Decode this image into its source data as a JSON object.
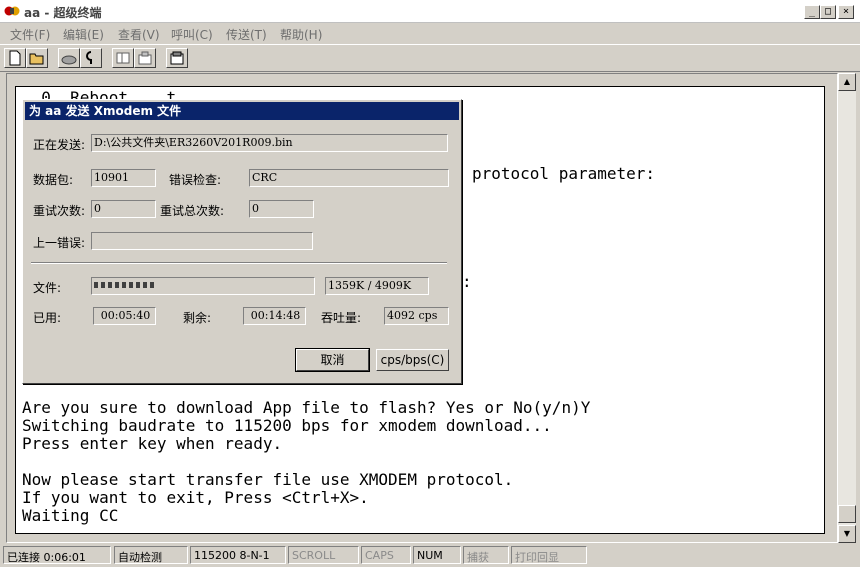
{
  "window": {
    "title": "aa - 超级终端",
    "minimize": "_",
    "maximize": "□",
    "close": "×"
  },
  "menu": [
    "文件(F)",
    "编辑(E)",
    "查看(V)",
    "呼叫(C)",
    "传送(T)",
    "帮助(H)"
  ],
  "toolbar": [
    "new-icon",
    "open-icon",
    "call-icon",
    "disconnect-icon",
    "send-icon",
    "receive-icon",
    "properties-icon"
  ],
  "terminal": {
    "top_partial": "  0. Reboot    t",
    "mid_fragment_1": "protocol parameter:",
    "mid_fragment_2": ":",
    "lines": [
      "Are you sure to download App file to flash? Yes or No(y/n)Y",
      "Switching baudrate to 115200 bps for xmodem download...",
      "Press enter key when ready.",
      "",
      "Now please start transfer file use XMODEM protocol.",
      "If you want to exit, Press <Ctrl+X>.",
      "Waiting CC"
    ]
  },
  "dialog": {
    "title": "为 aa 发送 Xmodem 文件",
    "sending_label": "正在发送:",
    "sending_value": "D:\\公共文件夹\\ER3260V201R009.bin",
    "packet_label": "数据包:",
    "packet_value": "10901",
    "error_check_label": "错误检查:",
    "error_check_value": "CRC",
    "retries_label": "重试次数:",
    "retries_value": "0",
    "total_retries_label": "重试总次数:",
    "total_retries_value": "0",
    "last_error_label": "上一错误:",
    "last_error_value": "",
    "file_label": "文件:",
    "file_progress_text": "1359K / 4909K",
    "file_progress_fraction": 0.277,
    "elapsed_label": "已用:",
    "elapsed_value": "00:05:40",
    "remaining_label": "剩余:",
    "remaining_value": "00:14:48",
    "throughput_label": "吞吐量:",
    "throughput_value": "4092 cps",
    "cancel_label": "取消",
    "cpsbps_label": "cps/bps(C)"
  },
  "status": {
    "connected": "已连接 0:06:01",
    "detect": "自动检测",
    "baud": "115200 8-N-1",
    "scroll": "SCROLL",
    "caps": "CAPS",
    "num": "NUM",
    "capture": "捕获",
    "print": "打印回显"
  }
}
